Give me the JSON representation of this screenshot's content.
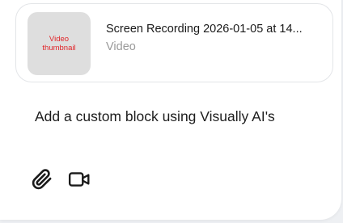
{
  "attachment": {
    "thumbnail_label": "Video\nthumbnail",
    "file_name": "Screen Recording 2026-01-05 at 14...",
    "file_type": "Video"
  },
  "composer": {
    "text": "Add a custom block using Visually AI's"
  },
  "toolbar": {
    "items": [
      {
        "icon": "paperclip-icon"
      },
      {
        "icon": "video-camera-icon"
      }
    ]
  },
  "colors": {
    "thumbnail_bg": "#dedede",
    "thumbnail_text": "#e1262a",
    "card_border": "#e3e5e8",
    "muted_text": "#9a9a9a"
  }
}
